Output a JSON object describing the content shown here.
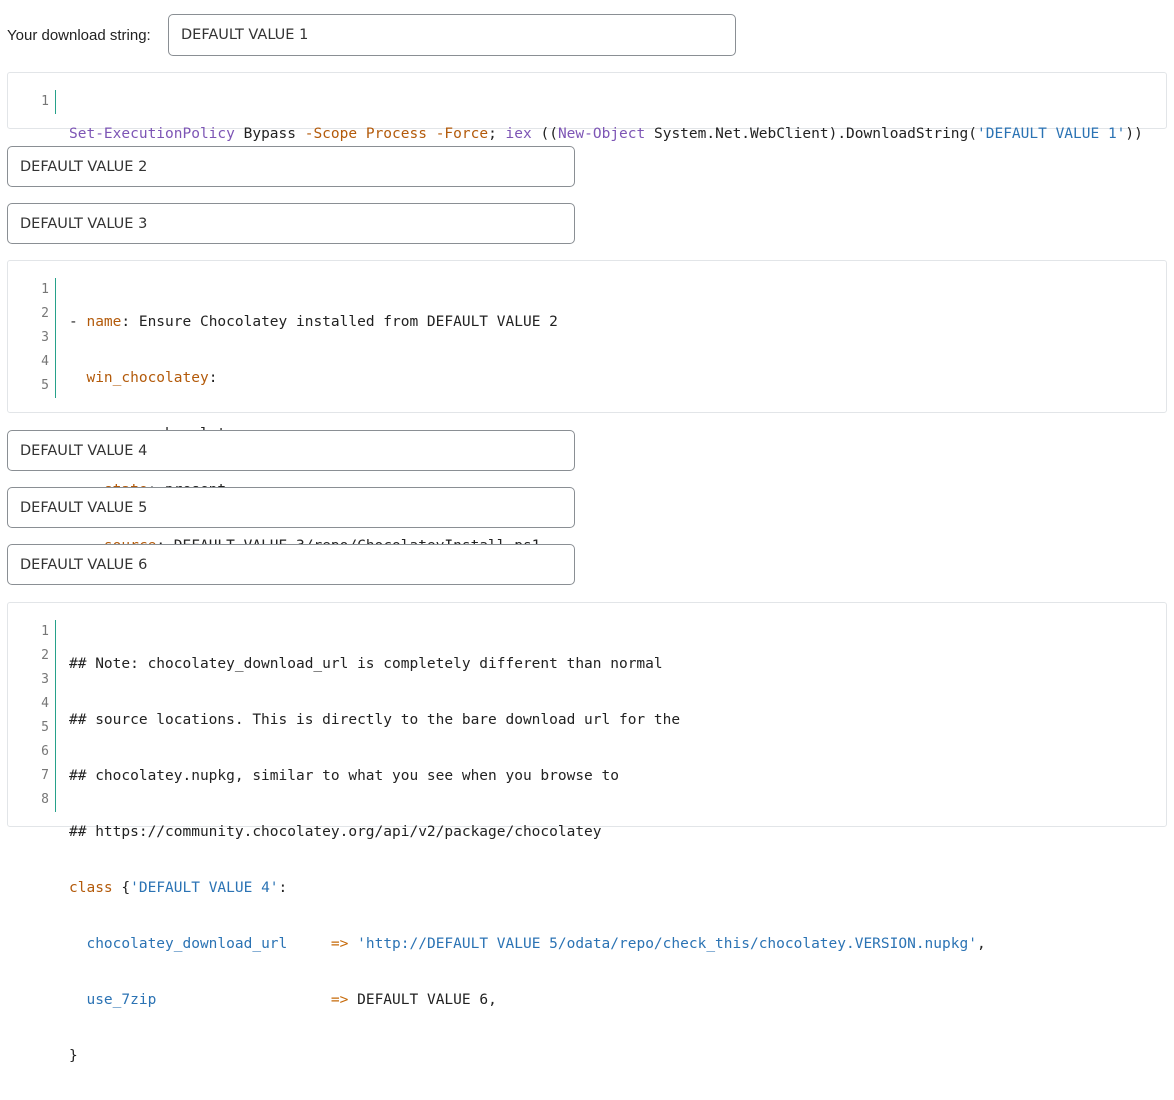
{
  "download": {
    "label": "Your download string:",
    "value1": "DEFAULT VALUE 1"
  },
  "inputs": {
    "value2": "DEFAULT VALUE 2",
    "value3": "DEFAULT VALUE 3",
    "value4": "DEFAULT VALUE 4",
    "value5": "DEFAULT VALUE 5",
    "value6": "DEFAULT VALUE 6"
  },
  "code1": {
    "line_numbers": [
      "1"
    ],
    "tokens": {
      "cmd": "Set-ExecutionPolicy",
      "bypass": " Bypass ",
      "scope": "-Scope",
      "sp1": " ",
      "process": "Process",
      "sp2": " ",
      "force": "-Force",
      "semi": "; ",
      "iex": "iex",
      "paren": " ((",
      "newobj": "New-Object",
      "rest": " System.Net.WebClient).DownloadString(",
      "str": "'DEFAULT VALUE 1'",
      "close": "))"
    }
  },
  "code2": {
    "line_numbers": [
      "1",
      "2",
      "3",
      "4",
      "5"
    ],
    "l1_dash": "- ",
    "l1_key": "name",
    "l1_val": ": Ensure Chocolatey installed from DEFAULT VALUE 2",
    "l2_indent": "  ",
    "l2_key": "win_chocolatey",
    "l2_val": ":",
    "l3_indent": "    ",
    "l3_key": "name",
    "l3_val": ": chocolatey",
    "l4_indent": "    ",
    "l4_key": "state",
    "l4_val": ": present",
    "l5_indent": "    ",
    "l5_key": "source",
    "l5_val": ": DEFAULT VALUE 3/repo/ChocolateyInstall.ps1"
  },
  "code3": {
    "line_numbers": [
      "1",
      "2",
      "3",
      "4",
      "5",
      "6",
      "7",
      "8"
    ],
    "l1": "## Note: chocolatey_download_url is completely different than normal",
    "l2": "## source locations. This is directly to the bare download url for the",
    "l3": "## chocolatey.nupkg, similar to what you see when you browse to",
    "l4": "## https://community.chocolatey.org/api/v2/package/chocolatey",
    "l5_kw": "class",
    "l5_brace": " {",
    "l5_str": "'DEFAULT VALUE 4'",
    "l5_colon": ":",
    "l6_indent": "  ",
    "l6_key": "chocolatey_download_url",
    "l6_pad": "     ",
    "l6_arrow": "=>",
    "l6_sp": " ",
    "l6_str": "'http://DEFAULT VALUE 5/odata/repo/check_this/chocolatey.VERSION.nupkg'",
    "l6_end": ",",
    "l7_indent": "  ",
    "l7_key": "use_7zip",
    "l7_pad": "                    ",
    "l7_arrow": "=>",
    "l7_val": " DEFAULT VALUE 6,",
    "l8": "}"
  }
}
